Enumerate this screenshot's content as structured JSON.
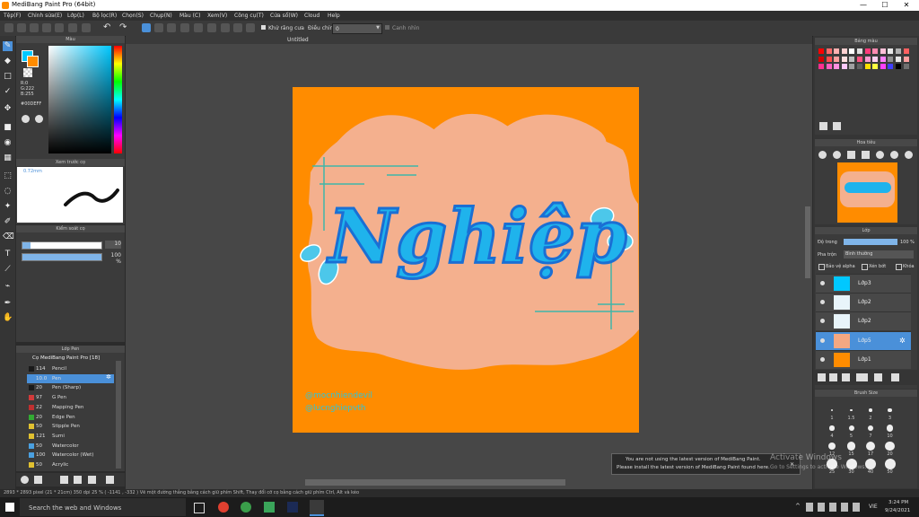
{
  "window": {
    "title": "MediBang Paint Pro (64bit)",
    "minimize": "—",
    "maximize": "☐",
    "close": "✕"
  },
  "menu": [
    "Tệp(F)",
    "Chỉnh sửa(E)",
    "Lớp(L)",
    "Bộ lọc(R)",
    "Chọn(S)",
    "Chụp(N)",
    "Màu (C)",
    "Xem(V)",
    "Công cụ(T)",
    "Cửa sổ(W)",
    "Cloud",
    "Help"
  ],
  "toolbar": {
    "antialias_label": "Khử răng cưa",
    "correction_label": "Điều chỉnh",
    "correction_value": "0",
    "snap_label": "Canh nhìn"
  },
  "canvas": {
    "tab_title": "Untitled",
    "art_text": "Nghiệp",
    "handle1": "@mocnhiendevil",
    "handle2": "@lucnghiepvth"
  },
  "panels": {
    "color": {
      "title": "Màu",
      "r": "R:0",
      "g": "G:222",
      "b": "B:255",
      "hex": "#00DEFF"
    },
    "brush_preview": {
      "title": "Xem trước cọ",
      "size": "0.72mm"
    },
    "brush_control": {
      "title": "Kiểm soát cọ",
      "size_value": "10",
      "opacity_value": "100 %"
    },
    "brush_list": {
      "title": "Lớp Pen",
      "group": "Cọ MediBang Paint Pro [18]"
    },
    "palette": {
      "title": "Bảng màu"
    },
    "navigator": {
      "title": "Hoa tiêu"
    },
    "layers": {
      "title": "Lớp",
      "opacity_label": "Độ trong",
      "opacity_value": "100 %",
      "blend_label": "Pha trộn",
      "blend_value": "Bình thường",
      "protect_alpha": "Bảo vệ alpha",
      "clipping": "Xén bớt",
      "lock": "Khóa"
    },
    "brush_size": {
      "title": "Brush Size"
    }
  },
  "brushes": [
    {
      "num": "114",
      "name": "Pencil",
      "color": "#1a1a1a"
    },
    {
      "num": "10.0",
      "name": "Pen",
      "color": "#4a90d9"
    },
    {
      "num": "20",
      "name": "Pen (Sharp)",
      "color": "#1a1a1a"
    },
    {
      "num": "97",
      "name": "G Pen",
      "color": "#d23a3a"
    },
    {
      "num": "22",
      "name": "Mapping Pen",
      "color": "#c03030"
    },
    {
      "num": "20",
      "name": "Edge Pen",
      "color": "#33aa33"
    },
    {
      "num": "50",
      "name": "Stipple Pen",
      "color": "#e0c030"
    },
    {
      "num": "121",
      "name": "Sumi",
      "color": "#e0c030"
    },
    {
      "num": "50",
      "name": "Watercolor",
      "color": "#4aa0e0"
    },
    {
      "num": "100",
      "name": "Watercolor (Wet)",
      "color": "#4aa0e0"
    },
    {
      "num": "50",
      "name": "Acrylic",
      "color": "#e0c030"
    }
  ],
  "layers": [
    {
      "name": "Lớp3",
      "thumb": "#00c8ff"
    },
    {
      "name": "Lớp2",
      "thumb": "#e8f4fa"
    },
    {
      "name": "Lớp2",
      "thumb": "#e8f4fa"
    },
    {
      "name": "Lớp5",
      "thumb": "#f4a882"
    },
    {
      "name": "Lớp1",
      "thumb": "#ff8c00"
    }
  ],
  "brush_sizes": [
    "1",
    "1.5",
    "2",
    "3",
    "4",
    "5",
    "7",
    "10",
    "12",
    "15",
    "17",
    "20",
    "25",
    "30",
    "40",
    "50"
  ],
  "status": {
    "text": "2893 * 2893 pixel  (21 * 21cm)  350 dpi  25 %  ( -1141 , -332 )  Vẽ một đường thẳng bằng cách giữ phím Shift, Thay đổi cỡ cọ bằng cách giữ phím Ctrl, Alt và kéo"
  },
  "notification": {
    "line1": "You are not using the latest version of MediBang Paint.",
    "line2": "Please install the latest version of MediBang Paint found here."
  },
  "watermark": {
    "line1": "Activate Windows",
    "line2": "Go to Settings to activate Windows."
  },
  "taskbar": {
    "search": "Search the web and Windows",
    "time": "3:24 PM",
    "date": "9/24/2021",
    "lang": "VIE"
  },
  "colors": {
    "accent": "#4a90d9",
    "orange": "#ff8c00",
    "peach": "#f4b08e",
    "cyan": "#00c8ff"
  }
}
